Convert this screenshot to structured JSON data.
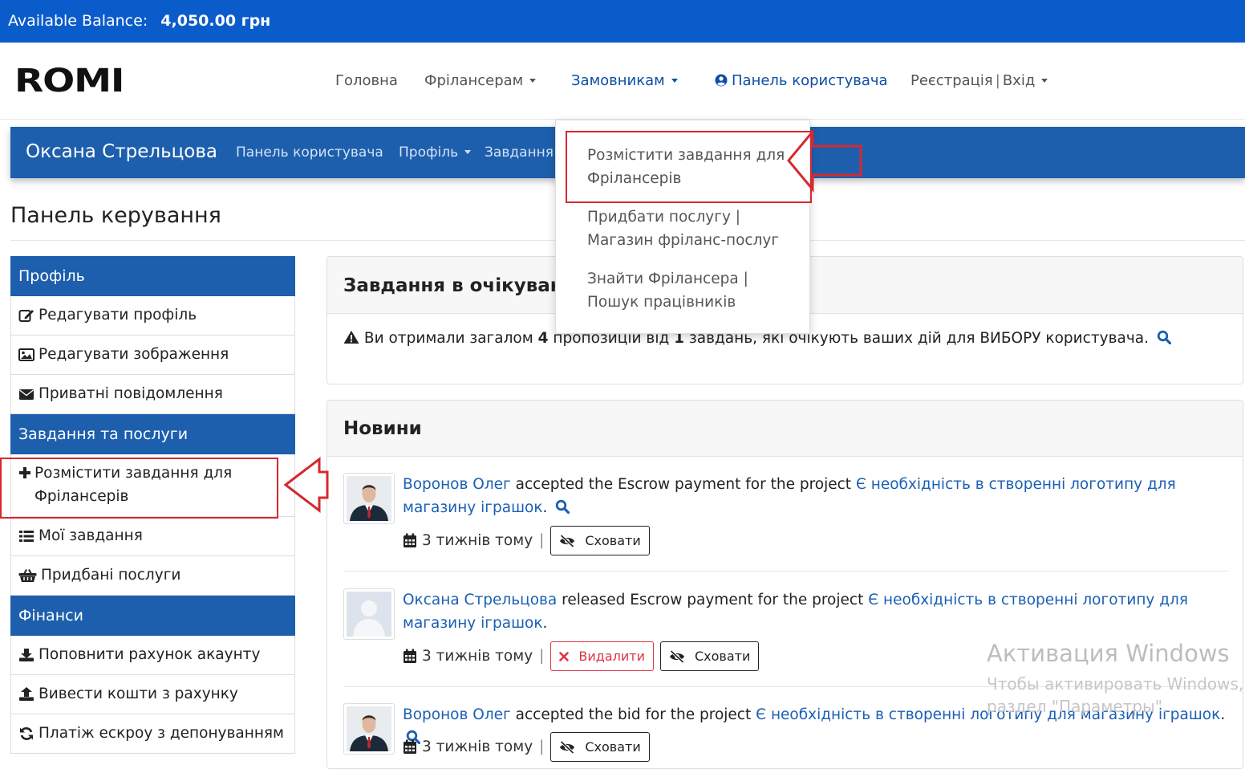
{
  "balance": {
    "label": "Available Balance:",
    "amount": "4,050.00 грн"
  },
  "logo": "ROMI",
  "main_nav": {
    "home": "Головна",
    "freelancers": "Фрілансерам",
    "clients": "Замовникам",
    "user_panel": "Панель користувача",
    "register": "Реєстрація",
    "login": "Вхід"
  },
  "user_bar": {
    "name": "Оксана Стрельцова",
    "links": [
      "Панель користувача",
      "Профіль",
      "Завдання"
    ]
  },
  "page_title": "Панель керування",
  "sidebar": {
    "profile_header": "Профіль",
    "edit_profile": "Редагувати профіль",
    "edit_images": "Редагувати зображення",
    "messages": "Приватні повідомлення",
    "tasks_header": "Завдання та послуги",
    "post_task": "Розмістити завдання для Фрілансерів",
    "my_tasks": "Мої завдання",
    "purchased": "Придбані послуги",
    "finance_header": "Фінанси",
    "topup": "Поповнити рахунок акаунту",
    "withdraw": "Вивести кошти з рахунку",
    "escrow": "Платіж ескроу з депонуванням"
  },
  "pending": {
    "title": "Завдання в очікуванні",
    "text_before": "Ви отримали загалом",
    "count_offers": "4",
    "text_mid": "пропозицій від",
    "count_tasks": "1",
    "text_after": "завдань, які очікують ваших дій для ВИБОРУ користувача."
  },
  "news": {
    "title": "Новини",
    "items": [
      {
        "user": "Воронов Олег",
        "action": "accepted the Escrow payment for the project",
        "project": "Є необхідність в створенні логотипу для магазину іграшок",
        "end": ".",
        "time": "3 тижнів тому",
        "hide": "Сховати"
      },
      {
        "user": "Оксана Стрельцова",
        "action": "released Escrow payment for the project",
        "project": "Є необхідність в створенні логотипу для магазину іграшок",
        "end": ".",
        "time": "3 тижнів тому",
        "delete": "Видалити",
        "hide": "Сховати"
      },
      {
        "user": "Воронов Олег",
        "action": "accepted the bid for the project",
        "project": "Є необхідність в створенні логотипу для магазину іграшок",
        "end": ".",
        "time": "3 тижнів тому",
        "hide": "Сховати"
      }
    ]
  },
  "dropdown": {
    "item1": "Розмістити завдання для Фрілансерів",
    "item2": "Придбати послугу | Магазин фріланс-послуг",
    "item3": "Знайти Фрілансера | Пошук працівників"
  },
  "watermark": {
    "title": "Активация Windows",
    "line1": "Чтобы активировать Windows, п",
    "line2": "раздел \"Параметры\"."
  },
  "colors": {
    "brand_blue": "#0b5ccb",
    "panel_blue": "#1d5fad",
    "link": "#1a5fb4",
    "highlight": "#d6282f"
  }
}
